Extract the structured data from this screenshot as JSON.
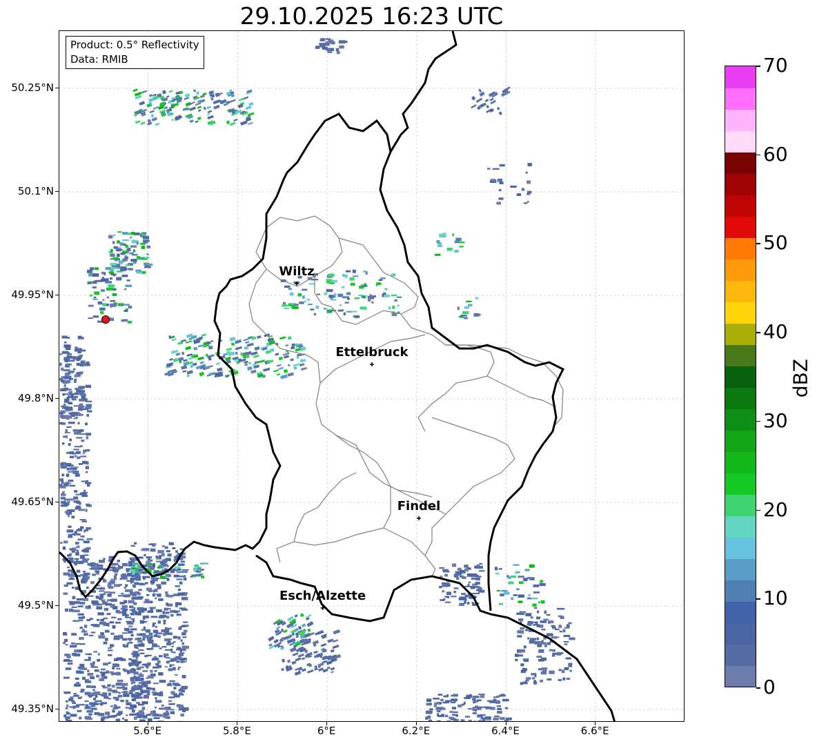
{
  "title": "29.10.2025 16:23 UTC",
  "info_box": {
    "product": "Product: 0.5° Reflectivity",
    "data": "Data: RMIB"
  },
  "lat_labels": [
    "50.25°N",
    "50.1°N",
    "49.95°N",
    "49.8°N",
    "49.65°N",
    "49.5°N",
    "49.35°N"
  ],
  "lon_labels": [
    "5.6°E",
    "5.8°E",
    "6°E",
    "6.2°E",
    "6.4°E",
    "6.6°E"
  ],
  "cities": [
    {
      "name": "Wiltz",
      "lat": 49.967,
      "lon": 5.932
    },
    {
      "name": "Ettelbruck",
      "lat": 49.85,
      "lon": 6.1
    },
    {
      "name": "Findel",
      "lat": 49.627,
      "lon": 6.205
    },
    {
      "name": "Esch/Alzette",
      "lat": 49.497,
      "lon": 5.99
    }
  ],
  "radar_site": {
    "lat": 49.915,
    "lon": 5.505,
    "color": "#e8141e"
  },
  "extent": {
    "lon": [
      5.4,
      6.8
    ],
    "lat": [
      49.3,
      50.3
    ]
  },
  "colorbar": {
    "label": "dBZ",
    "min": 0,
    "max": 70,
    "ticks": [
      "0",
      "10",
      "20",
      "30",
      "40",
      "50",
      "60",
      "70"
    ],
    "colors": [
      "#6a7bac",
      "#556ca3",
      "#4a64a4",
      "#4262a9",
      "#4f7fb3",
      "#5a9ec7",
      "#66c2de",
      "#61d6c1",
      "#3fd470",
      "#15c823",
      "#12b81a",
      "#13a616",
      "#0e8e15",
      "#0a7a10",
      "#08600c",
      "#47791a",
      "#aaae08",
      "#ffd60a",
      "#fdb90b",
      "#ff9b0a",
      "#ff7b04",
      "#e20909",
      "#be0404",
      "#a10404",
      "#7a0404",
      "#ffdafb",
      "#ffb4fc",
      "#ff6ffc",
      "#e83df0"
    ]
  }
}
